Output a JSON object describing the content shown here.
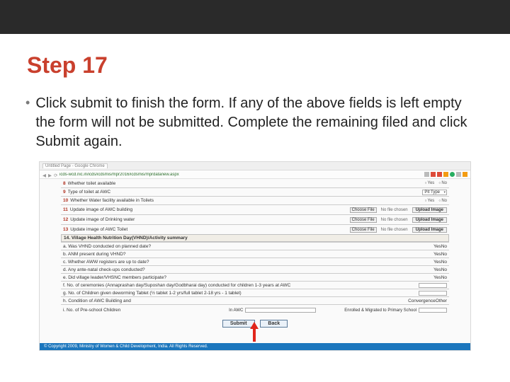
{
  "title": "Step 17",
  "bullet": "Click submit to finish the form. If any of the above fields is left empty the form will not be submitted. Complete the remaining filed and click Submit again.",
  "browser": {
    "tab": "Untitled Page - Google Chrome",
    "url": "icds-wcd.nic.in/icds/icdsmis/mpr2016/icdsmis/mprdatanew.aspx"
  },
  "form": {
    "q8": {
      "num": "8",
      "label": "Whether toilet available",
      "opts": [
        "Yes",
        "No"
      ]
    },
    "q9": {
      "num": "9",
      "label": "Type of toilet at AWC",
      "select": "Pit Type"
    },
    "q10": {
      "num": "10",
      "label": "Whether Water facility available in Toilets",
      "opts": [
        "Yes",
        "No"
      ]
    },
    "q11": {
      "num": "11",
      "label": "Update image of AWC building",
      "choose": "Choose File",
      "nofile": "No file chosen",
      "upload": "Upload Image"
    },
    "q12": {
      "num": "12",
      "label": "Update image of Drinking water",
      "choose": "Choose File",
      "nofile": "No file chosen",
      "upload": "Upload Image"
    },
    "q13": {
      "num": "13",
      "label": "Update image of AWC Toilet",
      "choose": "Choose File",
      "nofile": "No file chosen",
      "upload": "Upload Image"
    },
    "header14": "14. Village Health Nutrition Day(VHND)/Activity summary",
    "a": {
      "label": "a. Was VHND conducted on planned date?",
      "opts": [
        "Yes",
        "No"
      ]
    },
    "b": {
      "label": "b. ANM present during VHND?",
      "opts": [
        "Yes",
        "No"
      ]
    },
    "c": {
      "label": "c. Whether AWW registers are up to date?",
      "opts": [
        "Yes",
        "No"
      ]
    },
    "d": {
      "label": "d. Any ante-natal check-ups conducted?",
      "opts": [
        "Yes",
        "No"
      ]
    },
    "e": {
      "label": "e. Did village leader/VHSNC members participate?",
      "opts": [
        "Yes",
        "No"
      ]
    },
    "f": {
      "label": "f. No. of ceremonies (Annaprashan day/Suposhan day/Godbharai day) conducted for children 1-3 years at AWC"
    },
    "g": {
      "label": "g. No. of Children given deworming Tablet (½ tablet 1-2 yrs/full tablet 2-18 yrs - 1 tablet)"
    },
    "h": {
      "label": "h. Condition of AWC Building and",
      "opts": [
        "Convergence",
        "Other"
      ]
    },
    "i": {
      "label": "i.   No. of Pre-school Children",
      "field": "In AWC",
      "right": "Enrolled & Migrated to Primary School"
    },
    "submit": "Submit",
    "back": "Back",
    "footer": "© Copyright 2009, Ministry of Women & Child Development, India. All Rights Reserved."
  }
}
